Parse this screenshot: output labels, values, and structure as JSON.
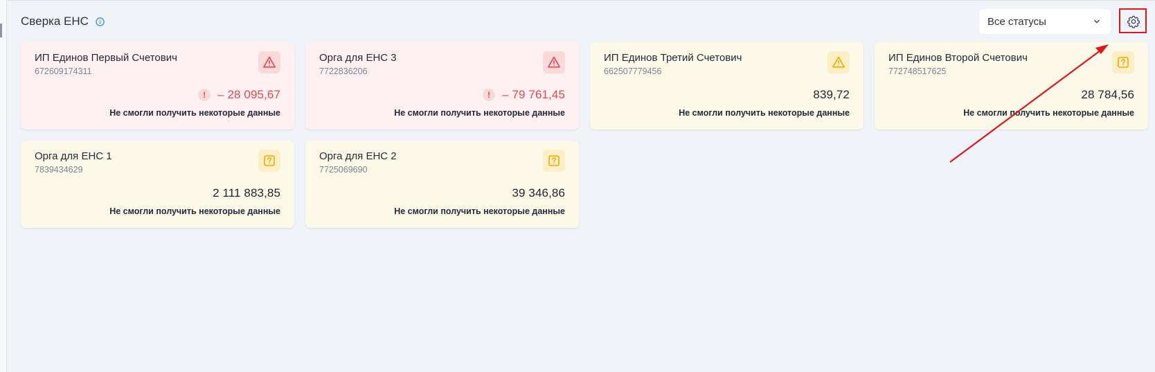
{
  "header": {
    "title": "Сверка ЕНС",
    "info_icon": "info-icon"
  },
  "filter": {
    "selected": "Все статусы",
    "icon": "chevron-down-icon"
  },
  "settings": {
    "icon": "gear-icon"
  },
  "colors": {
    "error": "#e5484d",
    "warning": "#f2a900",
    "error_bg": "#fff1f1",
    "warning_bg": "#fdf9e8",
    "annotation": "#e3141b",
    "link": "#2f8bd6"
  },
  "cards": [
    {
      "name": "ИП Единов Первый Счетович",
      "inn": "672609174311",
      "status": "error",
      "icon": "warning-triangle-icon",
      "badge": "!",
      "amount": "– 28 095,67",
      "note": "Не смогли получить некоторые данные"
    },
    {
      "name": "Орга для ЕНС 3",
      "inn": "7722836206",
      "status": "error",
      "icon": "warning-triangle-icon",
      "badge": "!",
      "amount": "– 79 761,45",
      "note": "Не смогли получить некоторые данные"
    },
    {
      "name": "ИП Единов Третий Счетович",
      "inn": "662507779456",
      "status": "warning",
      "icon": "warning-triangle-icon",
      "badge": "",
      "amount": "839,72",
      "note": "Не смогли получить некоторые данные"
    },
    {
      "name": "ИП Единов Второй Счетович",
      "inn": "772748517625",
      "status": "unknown",
      "icon": "question-icon",
      "badge": "",
      "amount": "28 784,56",
      "note": "Не смогли получить некоторые данные"
    },
    {
      "name": "Орга для ЕНС 1",
      "inn": "7839434629",
      "status": "unknown",
      "icon": "question-icon",
      "badge": "",
      "amount": "2 111 883,85",
      "note": "Не смогли получить некоторые данные"
    },
    {
      "name": "Орга для ЕНС 2",
      "inn": "7725069690",
      "status": "unknown",
      "icon": "question-icon",
      "badge": "",
      "amount": "39 346,86",
      "note": "Не смогли получить некоторые данные"
    }
  ]
}
